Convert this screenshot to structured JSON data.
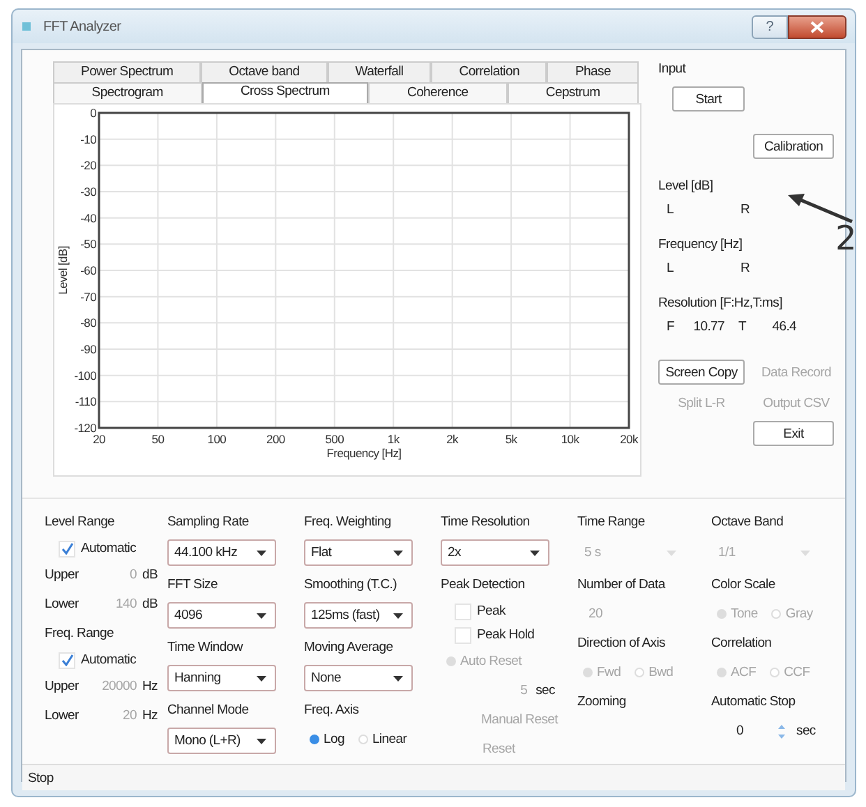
{
  "window": {
    "title": "FFT Analyzer",
    "help": "?"
  },
  "tabs": {
    "back_row": [
      {
        "label": "Power Spectrum",
        "selected": false
      },
      {
        "label": "Octave band",
        "selected": false
      },
      {
        "label": "Waterfall",
        "selected": false
      },
      {
        "label": "Correlation",
        "selected": false
      },
      {
        "label": "Phase",
        "selected": false
      }
    ],
    "front_row": [
      {
        "label": "Spectrogram",
        "selected": false
      },
      {
        "label": "Cross Spectrum",
        "selected": true
      },
      {
        "label": "Coherence",
        "selected": false
      },
      {
        "label": "Cepstrum",
        "selected": false
      }
    ]
  },
  "chart_data": {
    "type": "line",
    "grid": true,
    "xlabel": "Frequency [Hz]",
    "ylabel": "Level [dB]",
    "ylim": [
      -120,
      0
    ],
    "categories": [
      "20",
      "50",
      "100",
      "200",
      "500",
      "1k",
      "2k",
      "5k",
      "10k",
      "20k"
    ],
    "yticks": [
      0,
      -10,
      -20,
      -30,
      -40,
      -50,
      -60,
      -70,
      -80,
      -90,
      -100,
      -110,
      -120
    ]
  },
  "side_panel": {
    "input_label": "Input",
    "start_button": "Start",
    "calibration_button": "Calibration",
    "level": {
      "title": "Level [dB]",
      "left": "L",
      "right": "R"
    },
    "frequency": {
      "title": "Frequency [Hz]",
      "left": "L",
      "right": "R"
    },
    "resolution": {
      "title": "Resolution [F:Hz,T:ms]",
      "f_label": "F",
      "f_value": "10.77",
      "t_label": "T",
      "t_value": "46.4"
    },
    "buttons": [
      {
        "label": "Screen Copy",
        "disabled": false
      },
      {
        "label": "Data Record",
        "disabled": true
      },
      {
        "label": "Split L-R",
        "disabled": true
      },
      {
        "label": "Output CSV",
        "disabled": true
      }
    ],
    "exit_button": "Exit"
  },
  "settings": [
    [
      {
        "kind": "heading",
        "text": "Level Range"
      },
      {
        "kind": "checkbox",
        "label": "Automatic",
        "checked": true,
        "disabled": false
      },
      {
        "kind": "range",
        "label": "Upper",
        "value": "0",
        "unit": "dB"
      },
      {
        "kind": "range",
        "label": "Lower",
        "value": "140",
        "unit": "dB"
      },
      {
        "kind": "heading",
        "text": "Freq. Range"
      },
      {
        "kind": "checkbox",
        "label": "Automatic",
        "checked": true,
        "disabled": false
      },
      {
        "kind": "range",
        "label": "Upper",
        "value": "20000",
        "unit": "Hz"
      },
      {
        "kind": "range",
        "label": "Lower",
        "value": "20",
        "unit": "Hz"
      }
    ],
    [
      {
        "kind": "heading",
        "text": "Sampling Rate"
      },
      {
        "kind": "dropdown",
        "value": "44.100 kHz",
        "disabled": false
      },
      {
        "kind": "heading",
        "text": "FFT Size"
      },
      {
        "kind": "dropdown",
        "value": "4096",
        "disabled": false
      },
      {
        "kind": "heading",
        "text": "Time Window"
      },
      {
        "kind": "dropdown",
        "value": "Hanning",
        "disabled": false
      },
      {
        "kind": "heading",
        "text": "Channel Mode"
      },
      {
        "kind": "dropdown",
        "value": "Mono (L+R)",
        "disabled": false
      }
    ],
    [
      {
        "kind": "heading",
        "text": "Freq. Weighting"
      },
      {
        "kind": "dropdown",
        "value": "Flat",
        "disabled": false
      },
      {
        "kind": "heading",
        "text": "Smoothing (T.C.)"
      },
      {
        "kind": "dropdown",
        "value": "125ms (fast)",
        "disabled": false
      },
      {
        "kind": "heading",
        "text": "Moving Average"
      },
      {
        "kind": "dropdown",
        "value": "None",
        "disabled": false
      },
      {
        "kind": "heading",
        "text": "Freq. Axis"
      },
      {
        "kind": "radios",
        "disabled": false,
        "options": [
          {
            "label": "Log",
            "selected": true
          },
          {
            "label": "Linear",
            "selected": false
          }
        ]
      }
    ],
    [
      {
        "kind": "heading",
        "text": "Time Resolution"
      },
      {
        "kind": "dropdown",
        "value": "2x",
        "disabled": false
      },
      {
        "kind": "heading",
        "text": "Peak Detection"
      },
      {
        "kind": "checkbox",
        "label": "Peak",
        "checked": false,
        "disabled": false
      },
      {
        "kind": "checkbox",
        "label": "Peak Hold",
        "checked": false,
        "disabled": false
      },
      {
        "kind": "radios",
        "disabled": true,
        "options": [
          {
            "label": "Auto Reset",
            "selected": true
          }
        ]
      },
      {
        "kind": "value",
        "value": "5",
        "unit": "sec"
      },
      {
        "kind": "note",
        "text": "Manual Reset"
      },
      {
        "kind": "button",
        "label": "Reset",
        "disabled": true
      }
    ],
    [
      {
        "kind": "heading",
        "text": "Time Range"
      },
      {
        "kind": "dropdown",
        "value": "5 s",
        "disabled": true
      },
      {
        "kind": "heading",
        "text": "Number of Data"
      },
      {
        "kind": "value",
        "value": "20"
      },
      {
        "kind": "heading",
        "text": "Direction of Axis"
      },
      {
        "kind": "radios",
        "disabled": true,
        "options": [
          {
            "label": "Fwd",
            "selected": true
          },
          {
            "label": "Bwd",
            "selected": false
          }
        ]
      },
      {
        "kind": "heading",
        "text": "Zooming"
      }
    ],
    [
      {
        "kind": "heading",
        "text": "Octave Band"
      },
      {
        "kind": "dropdown",
        "value": "1/1",
        "disabled": true
      },
      {
        "kind": "heading",
        "text": "Color Scale"
      },
      {
        "kind": "radios",
        "disabled": true,
        "options": [
          {
            "label": "Tone",
            "selected": true
          },
          {
            "label": "Gray",
            "selected": false
          }
        ]
      },
      {
        "kind": "heading",
        "text": "Correlation"
      },
      {
        "kind": "radios",
        "disabled": true,
        "options": [
          {
            "label": "ACF",
            "selected": true
          },
          {
            "label": "CCF",
            "selected": false
          }
        ]
      },
      {
        "kind": "heading",
        "text": "Automatic Stop"
      },
      {
        "kind": "spinner",
        "value": "0",
        "unit": "sec"
      }
    ]
  ],
  "status_bar": "Stop",
  "annotation": {
    "label": "2"
  }
}
